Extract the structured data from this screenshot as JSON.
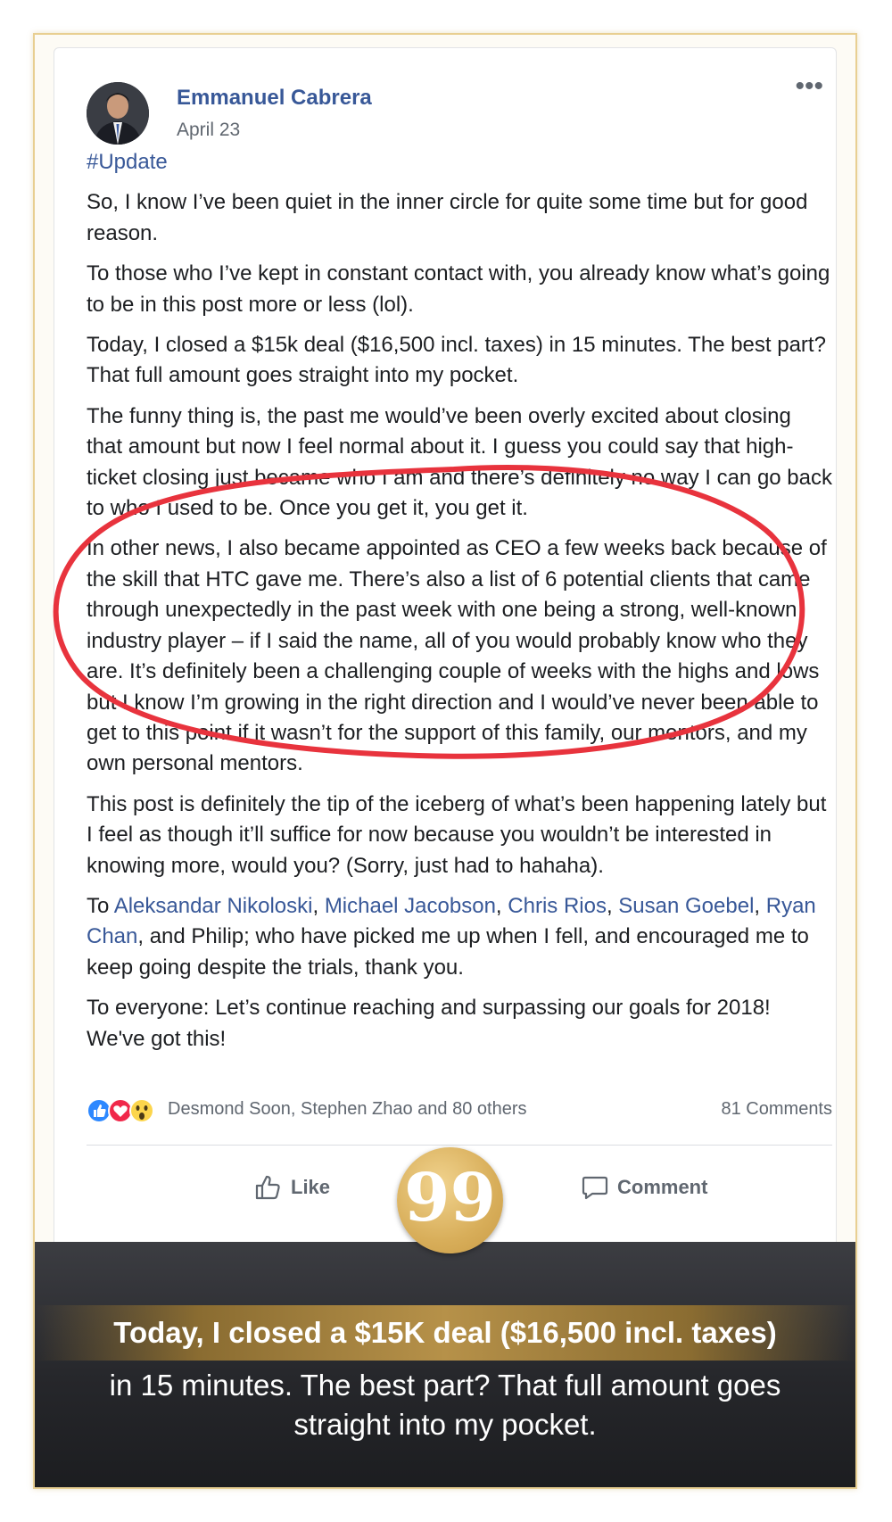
{
  "post": {
    "author": "Emmanuel Cabrera",
    "date": "April 23",
    "more_label": "•••",
    "hashtag": "#Update",
    "paragraphs": [
      "So, I know I’ve been quiet in the inner circle for quite some time but for good reason.",
      "To those who I’ve kept in constant contact with, you already know what’s going to be in this post more or less (lol).",
      "Today, I closed a $15k deal ($16,500 incl. taxes) in 15 minutes. The best part? That full amount goes straight into my pocket.",
      "The funny thing is, the past me would’ve been overly excited about closing that amount but now I feel normal about it. I guess you could say that high-ticket closing just became who I am and there’s definitely no way I can go back to who I used to be. Once you get it, you get it.",
      "In other news, I also became appointed as CEO a few weeks back because of the skill that HTC gave me. There’s also a list of 6 potential clients that came through unexpectedly in the past week with one being a strong, well-known industry player – if I said the name, all of you would probably know who they are. It’s definitely been a challenging couple of weeks with the highs and lows but I know I’m growing in the right direction and I would’ve never been able to get to this point if it wasn’t for the support of this family, our mentors, and my own personal mentors.",
      "This post is definitely the tip of the iceberg of what’s been happening lately but I feel as though it’ll suffice for now because you wouldn’t be interested in knowing more, would you? (Sorry, just had to hahaha)."
    ],
    "thanks": {
      "prefix": "To ",
      "sep": ", ",
      "names": [
        "Aleksandar Nikoloski",
        "Michael Jacobson",
        "Chris Rios",
        "Susan Goebel",
        "Ryan Chan"
      ],
      "suffix": ", and Philip; who have picked me up when I fell, and encouraged me to keep going despite the trials, thank you."
    },
    "closing": "To everyone: Let’s continue reaching and surpassing our goals for 2018! We've got this!",
    "reactions_text": "Desmond Soon, Stephen Zhao and 80 others",
    "reaction_icons": [
      "like-icon",
      "love-icon",
      "wow-icon"
    ],
    "comments_count": "81 Comments",
    "like_label": "Like",
    "comment_label": "Comment"
  },
  "banner": {
    "quote_mark": "99",
    "headline": "Today, I closed a $15K deal ($16,500 incl. taxes)",
    "subline": "in 15 minutes. The best part? That full amount goes straight into my pocket."
  },
  "colors": {
    "link": "#385898",
    "annotation": "#e8333d",
    "gold": "#d8ae5a",
    "frame": "#e8cf92",
    "banner_dark": "#26272b"
  }
}
